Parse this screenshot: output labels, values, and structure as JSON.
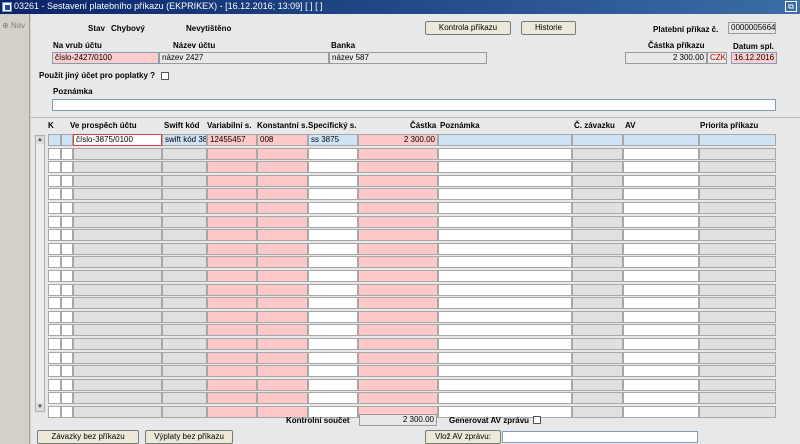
{
  "window": {
    "title": "03261 - Sestavení platebního příkazu (EKPRIKEX) - [16.12.2016; 13:09]  [ ] [ ]",
    "restore_icon": "restore-window-icon"
  },
  "nav": {
    "label": "Nav"
  },
  "header": {
    "stav_label": "Stav",
    "stav_value": "Chybový",
    "tisk_value": "Nevytištěno",
    "kontrola_btn": "Kontrola příkazu",
    "historie_btn": "Historie",
    "prikaz_label": "Platební příkaz č.",
    "prikaz_value": "0000005664",
    "vrub_label": "Na vrub účtu",
    "vrub_value": "číslo-2427/0100",
    "nazev_label": "Název účtu",
    "nazev_value": "název 2427",
    "banka_label": "Banka",
    "banka_value": "název 587",
    "castka_label": "Částka příkazu",
    "castka_value": "2 300.00",
    "mena": "CZK",
    "datum_label": "Datum spl.",
    "datum_value": "16.12.2016",
    "poplatky_label": "Použít jiný účet pro poplatky ?",
    "poznamka_label": "Poznámka",
    "poznamka_value": ""
  },
  "grid": {
    "columns": [
      "K",
      "Ve prospěch účtu",
      "Swift kód",
      "Variabilní s.",
      "Konstantní s.",
      "Specifický s.",
      "Částka",
      "Poznámka",
      "Č. závazku",
      "AV",
      "Priorita příkazu"
    ],
    "first_row": {
      "ucet": "číslo-3875/0100",
      "swift": "swift kód 38",
      "variabilni": "12455457",
      "konstantni": "008",
      "specificky": "ss 3875",
      "castka": "2 300.00",
      "poznamka": "",
      "zavazek": "",
      "av": "",
      "priorita": ""
    }
  },
  "footer": {
    "kontrolni_label": "Kontrolní součet",
    "kontrolni_value": "2 300.00",
    "generovat_label": "Generovat AV zprávu",
    "zavazky_btn": "Závazky bez příkazu",
    "vyplaty_btn": "Výplaty bez příkazu",
    "vloz_btn": "Vlož AV zprávu:",
    "vloz_value": ""
  }
}
